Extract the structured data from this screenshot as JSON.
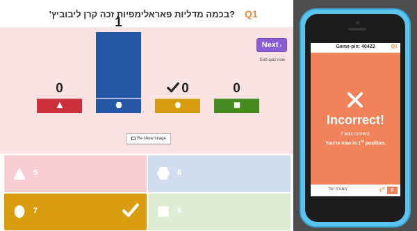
{
  "question": {
    "number": "Q1",
    "text": "?בכמה מדליות פאראלימפיות זכה קרן ליבוביץ'"
  },
  "controls": {
    "next_label": "Next",
    "next_chevron": "›",
    "end_quiz_label": "End quiz now",
    "reshow_label": "Re-show image"
  },
  "results": [
    {
      "shape": "triangle",
      "count": "0",
      "value": 0,
      "color": "#cc2f39",
      "correct": false
    },
    {
      "shape": "hexagon",
      "count": "1",
      "value": 1,
      "color": "#2457a6",
      "correct": false
    },
    {
      "shape": "circle",
      "count": "0",
      "value": 0,
      "color": "#d79b0b",
      "correct": true
    },
    {
      "shape": "square",
      "count": "0",
      "value": 0,
      "color": "#468a1e",
      "correct": false
    }
  ],
  "answers": [
    {
      "shape": "triangle",
      "label": "5",
      "color": "#f8ccd2",
      "correct": false
    },
    {
      "shape": "hexagon",
      "label": "6",
      "color": "#d1ddee",
      "correct": false
    },
    {
      "shape": "circle",
      "label": "7",
      "color": "#d89e10",
      "correct": true
    },
    {
      "shape": "square",
      "label": "8",
      "color": "#dcedd4",
      "correct": false
    }
  ],
  "phone": {
    "game_pin": "Game-pin: 40423",
    "question_number": "Q1",
    "result_title": "Incorrect!",
    "correct_answer_line": "7 was correct.",
    "position_prefix": "You're now in",
    "position_rank": "1",
    "position_suffix": "st",
    "position_end": "position.",
    "player_name": "המורה יעל",
    "rank_number": "1",
    "rank_suffix": "st",
    "score": "0"
  },
  "colors": {
    "accent_orange": "#f0883b",
    "next_purple": "#8a5fd6",
    "phone_body": "#5bc4ee",
    "phone_screen": "#f0835a"
  }
}
